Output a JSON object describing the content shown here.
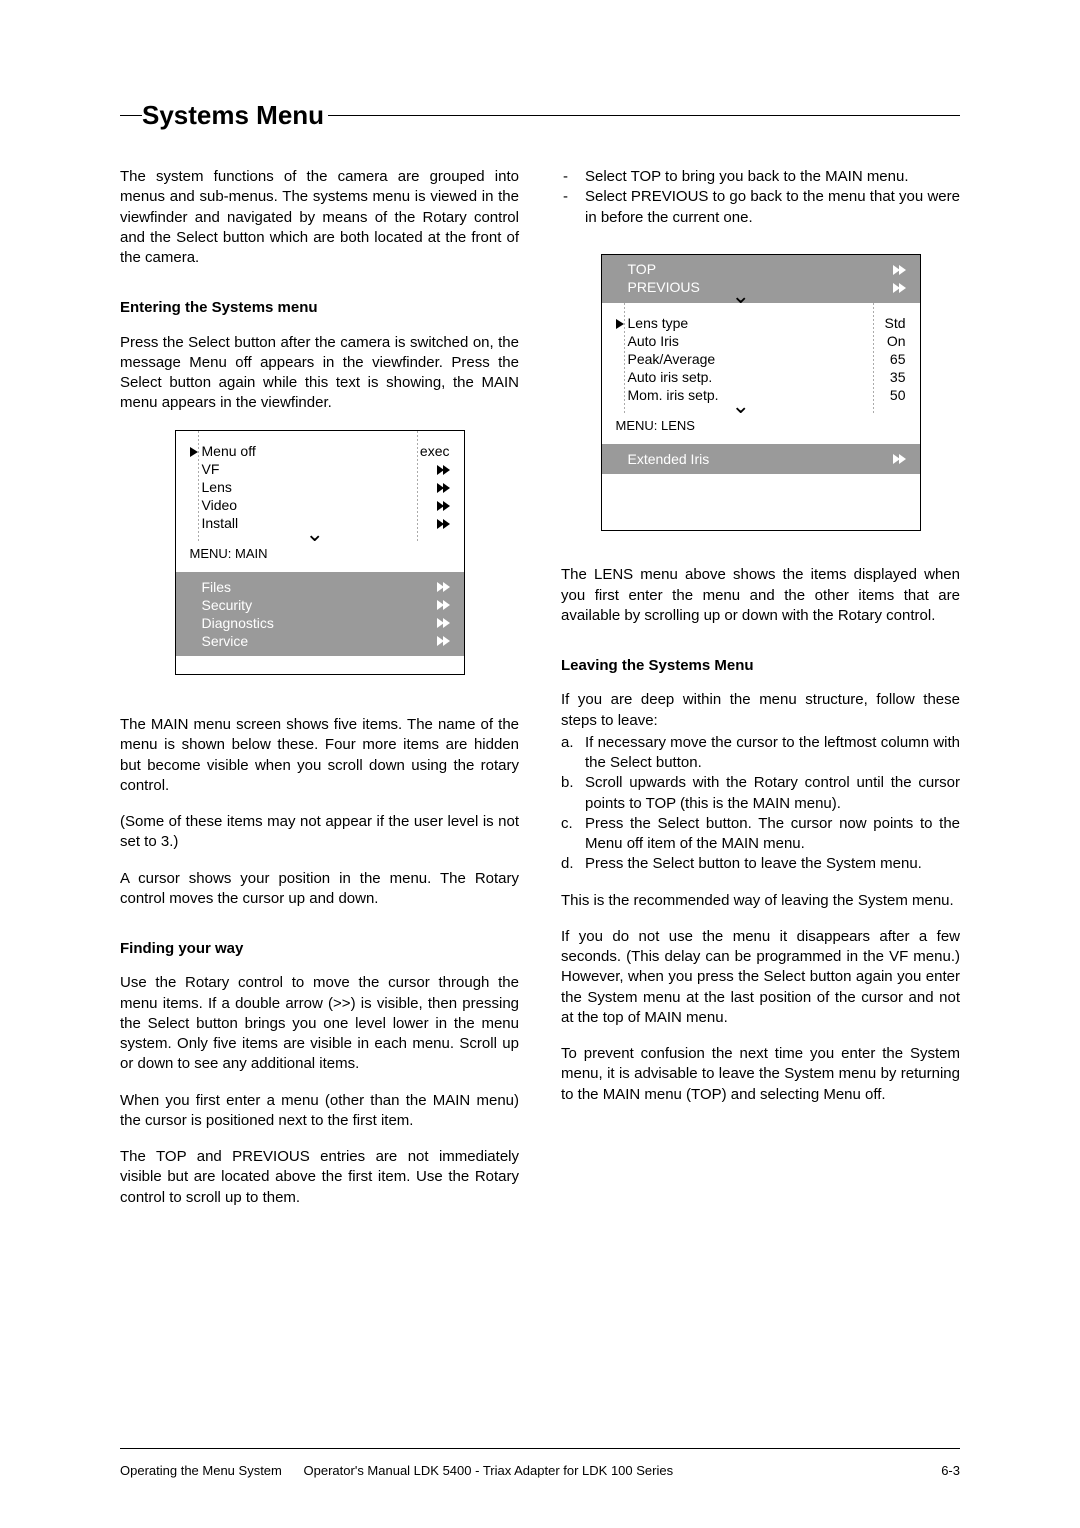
{
  "title": "Systems Menu",
  "left": {
    "intro": "The system functions of the camera are grouped into menus and sub-menus. The systems menu is viewed in the viewfinder and navigated by means of the Rotary control and the Select button which are both located at the front of the camera.",
    "entering_head": "Entering the Systems menu",
    "entering_p": "Press the Select button after the camera is switched on, the message Menu off appears in the viewfinder. Press the Select button again while this text is showing, the MAIN menu appears in the viewfinder.",
    "main_menu": {
      "visible": [
        {
          "label": "Menu off",
          "value": "exec",
          "cursor": true
        },
        {
          "label": "VF",
          "value": "arrows"
        },
        {
          "label": "Lens",
          "value": "arrows"
        },
        {
          "label": "Video",
          "value": "arrows"
        },
        {
          "label": "Install",
          "value": "arrows"
        }
      ],
      "title": "MENU:   MAIN",
      "hidden": [
        {
          "label": "Files",
          "value": "arrows"
        },
        {
          "label": "Security",
          "value": "arrows"
        },
        {
          "label": "Diagnostics",
          "value": "arrows"
        },
        {
          "label": "Service",
          "value": "arrows"
        }
      ]
    },
    "after_main_p1": "The MAIN menu screen shows five items. The name of the menu is shown below these. Four more items are hidden but become visible when you scroll down using the rotary control.",
    "after_main_p2": "(Some of these items may not appear if the user level is not set to 3.)",
    "after_main_p3": "A cursor shows your position in the menu. The Rotary control moves the cursor up and down.",
    "finding_head": "Finding your way",
    "finding_p1": "Use the Rotary control to move the cursor through the menu items. If a double arrow (>>) is visible, then pressing the Select button brings you one level lower in the menu system. Only five items are visible in each menu. Scroll up or down to see any additional items.",
    "finding_p2": "When you first enter a menu (other than the MAIN menu) the cursor is positioned next to the first item.",
    "finding_p3": " The TOP and PREVIOUS entries are not immediately visible but are located above the first item. Use the Rotary control to scroll up to them."
  },
  "right": {
    "dash": [
      "Select TOP to bring you back to the MAIN menu.",
      "Select PREVIOUS to go back to the menu that you were in before the current one."
    ],
    "lens_menu": {
      "hidden_top": [
        {
          "label": "TOP",
          "value": "arrows"
        },
        {
          "label": "PREVIOUS",
          "value": "arrows"
        }
      ],
      "visible": [
        {
          "label": "Lens type",
          "value": "Std",
          "cursor": true
        },
        {
          "label": "Auto Iris",
          "value": "On"
        },
        {
          "label": "Peak/Average",
          "value": "65"
        },
        {
          "label": "Auto iris setp.",
          "value": "35"
        },
        {
          "label": "Mom. iris setp.",
          "value": "50"
        }
      ],
      "title": "MENU:   LENS",
      "hidden_bottom": [
        {
          "label": "Extended Iris",
          "value": "arrows"
        }
      ]
    },
    "lens_p": "The LENS menu above shows the items displayed when you first enter the menu and the other items that are available by scrolling up or down with the Rotary control.",
    "leaving_head": "Leaving the Systems Menu",
    "leaving_intro": "If you are deep within the menu structure, follow these steps to leave:",
    "leaving_steps": [
      "If necessary move the cursor to the leftmost column with the Select button.",
      "Scroll upwards with the Rotary control until the cursor points to TOP (this is the MAIN menu).",
      "Press the Select button. The cursor now points to the Menu off item of the MAIN menu.",
      "Press the Select button to leave the System menu."
    ],
    "leaving_p1": "This is the recommended way of leaving the System menu.",
    "leaving_p2": "If you do not use the menu it disappears after a few seconds. (This delay can be programmed in the VF menu.) However, when you press the Select button again you enter the System menu at the last position of the cursor and not at the top of MAIN menu.",
    "leaving_p3": "To prevent confusion the next time you enter the System menu, it is advisable to leave the System menu by returning to the MAIN menu (TOP) and selecting Menu off."
  },
  "footer": {
    "left": "Operating the Menu System",
    "center": "Operator's Manual LDK 5400 - Triax Adapter for LDK 100 Series",
    "right": "6-3"
  }
}
